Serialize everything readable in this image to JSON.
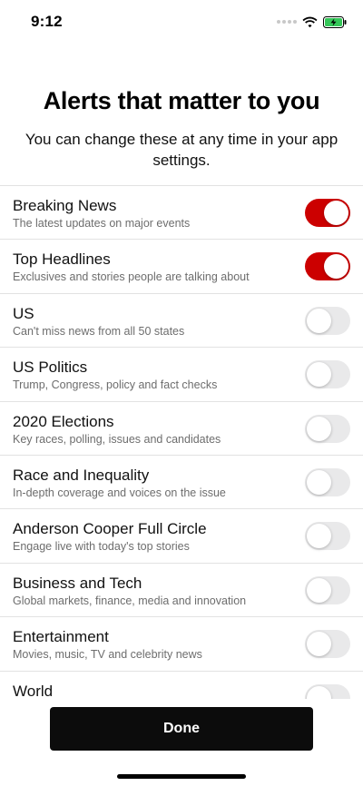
{
  "status_bar": {
    "time": "9:12",
    "battery_color": "#35c759"
  },
  "header": {
    "title": "Alerts that matter to you",
    "subtitle": "You can change these at any time in your app settings."
  },
  "alerts": [
    {
      "title": "Breaking News",
      "description": "The latest updates on major events",
      "enabled": true
    },
    {
      "title": "Top Headlines",
      "description": "Exclusives and stories people are talking about",
      "enabled": true
    },
    {
      "title": "US",
      "description": "Can't miss news from all 50 states",
      "enabled": false
    },
    {
      "title": "US Politics",
      "description": "Trump, Congress, policy and fact checks",
      "enabled": false
    },
    {
      "title": "2020 Elections",
      "description": "Key races, polling, issues and candidates",
      "enabled": false
    },
    {
      "title": "Race and Inequality",
      "description": "In-depth coverage and voices on the issue",
      "enabled": false
    },
    {
      "title": "Anderson Cooper Full Circle",
      "description": "Engage live with today's top stories",
      "enabled": false
    },
    {
      "title": "Business and Tech",
      "description": "Global markets, finance, media and innovation",
      "enabled": false
    },
    {
      "title": "Entertainment",
      "description": "Movies, music, TV and celebrity news",
      "enabled": false
    },
    {
      "title": "World",
      "description": "",
      "enabled": false
    }
  ],
  "footer": {
    "done_label": "Done"
  },
  "colors": {
    "toggle_on": "#cc0000",
    "toggle_off": "#e9e9ea",
    "button": "#0c0c0c"
  }
}
